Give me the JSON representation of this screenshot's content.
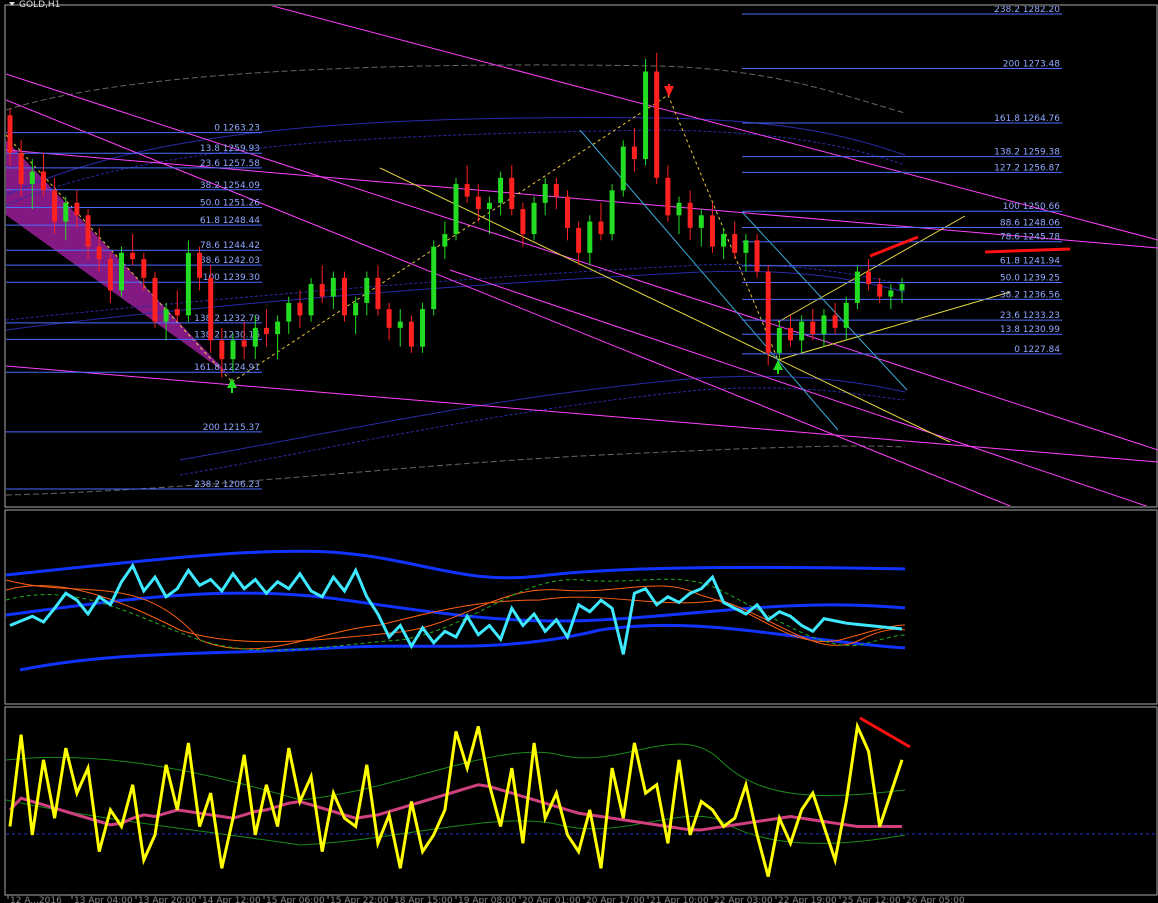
{
  "symbol_label": "GOLD,H1",
  "colors": {
    "background": "#000000",
    "fib_line": "#4a6cff",
    "fib_text": "#8fa8ff",
    "channel": "#ff40ff",
    "bull_candle": "#22dd22",
    "bear_candle": "#ff2020",
    "price_line": "#3ee8ff",
    "band": "#1133ff",
    "oscillator": "#ffff00",
    "osc_avg": "#d04080",
    "divergence": "#ff1010",
    "panel_border": "#aaaaaa"
  },
  "fib_left": [
    {
      "level": "0",
      "price": 1263.23,
      "label": "0 1263.23"
    },
    {
      "level": "13.8",
      "price": 1259.93,
      "label": "13.8 1259.93"
    },
    {
      "level": "23.6",
      "price": 1257.58,
      "label": "23.6 1257.58"
    },
    {
      "level": "38.2",
      "price": 1254.09,
      "label": "38.2 1254.09"
    },
    {
      "level": "50.0",
      "price": 1251.26,
      "label": "50.0 1251.26"
    },
    {
      "level": "61.8",
      "price": 1248.44,
      "label": "61.8 1248.44"
    },
    {
      "level": "78.6",
      "price": 1244.42,
      "label": "78.6 1244.42"
    },
    {
      "level": "88.6",
      "price": 1242.03,
      "label": "88.6 1242.03"
    },
    {
      "level": "100",
      "price": 1239.3,
      "label": "100 1239.30"
    },
    {
      "level": "138.2",
      "price": 1232.79,
      "label": "138.2 1232.79"
    },
    {
      "level": "138.2",
      "price": 1230.16,
      "label": "138.2 1230.16"
    },
    {
      "level": "161.8",
      "price": 1224.91,
      "label": "161.8 1224.91"
    },
    {
      "level": "200",
      "price": 1215.37,
      "label": "200 1215.37"
    },
    {
      "level": "238.2",
      "price": 1206.23,
      "label": "238.2 1206.23"
    }
  ],
  "fib_right": [
    {
      "level": "238.2",
      "price": 1282.2,
      "label": "238.2 1282.20"
    },
    {
      "level": "200",
      "price": 1273.48,
      "label": "200 1273.48"
    },
    {
      "level": "161.8",
      "price": 1264.76,
      "label": "161.8 1264.76"
    },
    {
      "level": "138.2",
      "price": 1259.38,
      "label": "138.2 1259.38"
    },
    {
      "level": "127.2",
      "price": 1256.87,
      "label": "127.2 1256.87"
    },
    {
      "level": "100",
      "price": 1250.66,
      "label": "100 1250.66"
    },
    {
      "level": "88.6",
      "price": 1248.06,
      "label": "88.6 1248.06"
    },
    {
      "level": "78.6",
      "price": 1245.78,
      "label": "78.6 1245.78"
    },
    {
      "level": "61.8",
      "price": 1241.94,
      "label": "61.8 1241.94"
    },
    {
      "level": "50.0",
      "price": 1239.25,
      "label": "50.0 1239.25"
    },
    {
      "level": "38.2",
      "price": 1236.56,
      "label": "38.2 1236.56"
    },
    {
      "level": "23.6",
      "price": 1233.23,
      "label": "23.6 1233.23"
    },
    {
      "level": "13.8",
      "price": 1230.99,
      "label": "13.8 1230.99"
    },
    {
      "level": "0",
      "price": 1227.84,
      "label": "0 1227.84"
    }
  ],
  "time_axis_labels": [
    "12 A...2016",
    "13 Apr 04:00",
    "13 Apr 20:00",
    "14 Apr 12:00",
    "15 Apr 06:00",
    "15 Apr 22:00",
    "18 Apr 15:00",
    "19 Apr 08:00",
    "20 Apr 01:00",
    "20 Apr 17:00",
    "21 Apr 10:00",
    "22 Apr 03:00",
    "22 Apr 19:00",
    "25 Apr 12:00",
    "26 Apr 05:00"
  ],
  "chart_data": [
    {
      "type": "candlestick",
      "title": "GOLD,H1",
      "ylim": [
        1200,
        1285
      ],
      "ohlc": [
        [
          1266,
          1267,
          1258,
          1260
        ],
        [
          1260,
          1262,
          1253,
          1255
        ],
        [
          1255,
          1259,
          1251,
          1257
        ],
        [
          1257,
          1260,
          1253,
          1254
        ],
        [
          1254,
          1256,
          1247,
          1249
        ],
        [
          1249,
          1253,
          1246,
          1252
        ],
        [
          1252,
          1254,
          1248,
          1250
        ],
        [
          1250,
          1251,
          1243,
          1245
        ],
        [
          1245,
          1248,
          1241,
          1243
        ],
        [
          1243,
          1244,
          1236,
          1238
        ],
        [
          1238,
          1245,
          1237,
          1244
        ],
        [
          1244,
          1247,
          1242,
          1243
        ],
        [
          1243,
          1244,
          1238,
          1240
        ],
        [
          1240,
          1241,
          1232,
          1233
        ],
        [
          1233,
          1236,
          1230,
          1235
        ],
        [
          1235,
          1238,
          1233,
          1234
        ],
        [
          1234,
          1246,
          1233,
          1244
        ],
        [
          1244,
          1245,
          1238,
          1240
        ],
        [
          1240,
          1242,
          1228,
          1230
        ],
        [
          1230,
          1232,
          1224,
          1227
        ],
        [
          1227,
          1231,
          1225,
          1230
        ],
        [
          1230,
          1233,
          1227,
          1229
        ],
        [
          1229,
          1234,
          1227,
          1232
        ],
        [
          1232,
          1235,
          1229,
          1231
        ],
        [
          1231,
          1234,
          1227,
          1233
        ],
        [
          1233,
          1237,
          1231,
          1236
        ],
        [
          1236,
          1238,
          1232,
          1234
        ],
        [
          1234,
          1240,
          1233,
          1239
        ],
        [
          1239,
          1242,
          1236,
          1237
        ],
        [
          1237,
          1241,
          1235,
          1240
        ],
        [
          1240,
          1241,
          1233,
          1234
        ],
        [
          1234,
          1237,
          1231,
          1236
        ],
        [
          1236,
          1241,
          1234,
          1240
        ],
        [
          1240,
          1242,
          1234,
          1235
        ],
        [
          1235,
          1236,
          1230,
          1232
        ],
        [
          1232,
          1235,
          1229,
          1233
        ],
        [
          1233,
          1234,
          1228,
          1229
        ],
        [
          1229,
          1236,
          1228,
          1235
        ],
        [
          1235,
          1246,
          1234,
          1245
        ],
        [
          1245,
          1249,
          1243,
          1247
        ],
        [
          1247,
          1256,
          1246,
          1255
        ],
        [
          1255,
          1258,
          1252,
          1253
        ],
        [
          1253,
          1255,
          1249,
          1251
        ],
        [
          1251,
          1253,
          1247,
          1252
        ],
        [
          1252,
          1257,
          1250,
          1256
        ],
        [
          1256,
          1258,
          1250,
          1251
        ],
        [
          1251,
          1252,
          1245,
          1247
        ],
        [
          1247,
          1253,
          1246,
          1252
        ],
        [
          1252,
          1256,
          1250,
          1255
        ],
        [
          1255,
          1256,
          1251,
          1253
        ],
        [
          1253,
          1254,
          1246,
          1248
        ],
        [
          1248,
          1249,
          1242,
          1244
        ],
        [
          1244,
          1250,
          1242,
          1249
        ],
        [
          1249,
          1252,
          1246,
          1247
        ],
        [
          1247,
          1255,
          1246,
          1254
        ],
        [
          1254,
          1262,
          1253,
          1261
        ],
        [
          1261,
          1264,
          1257,
          1259
        ],
        [
          1259,
          1275,
          1258,
          1273
        ],
        [
          1273,
          1276,
          1255,
          1256
        ],
        [
          1256,
          1258,
          1249,
          1250
        ],
        [
          1250,
          1253,
          1247,
          1252
        ],
        [
          1252,
          1254,
          1246,
          1248
        ],
        [
          1248,
          1251,
          1245,
          1250
        ],
        [
          1250,
          1252,
          1244,
          1245
        ],
        [
          1245,
          1248,
          1243,
          1247
        ],
        [
          1247,
          1249,
          1243,
          1244
        ],
        [
          1244,
          1247,
          1241,
          1246
        ],
        [
          1246,
          1247,
          1240,
          1241
        ],
        [
          1241,
          1242,
          1226,
          1228
        ],
        [
          1228,
          1233,
          1227,
          1232
        ],
        [
          1232,
          1234,
          1229,
          1230
        ],
        [
          1230,
          1234,
          1228,
          1233
        ],
        [
          1233,
          1235,
          1230,
          1231
        ],
        [
          1231,
          1235,
          1229,
          1234
        ],
        [
          1234,
          1236,
          1231,
          1232
        ],
        [
          1232,
          1237,
          1230,
          1236
        ],
        [
          1236,
          1242,
          1235,
          1241
        ],
        [
          1241,
          1243,
          1238,
          1239
        ],
        [
          1239,
          1240,
          1236,
          1237
        ],
        [
          1237,
          1239,
          1235,
          1238
        ],
        [
          1238,
          1240,
          1236,
          1239
        ]
      ]
    },
    {
      "type": "line",
      "series": [
        {
          "values": [
            0.3,
            0.34,
            0.38,
            0.33,
            0.45,
            0.58,
            0.52,
            0.4,
            0.55,
            0.48,
            0.68,
            0.82,
            0.6,
            0.72,
            0.55,
            0.62,
            0.78,
            0.65,
            0.7,
            0.6,
            0.75,
            0.62,
            0.7,
            0.58,
            0.68,
            0.62,
            0.75,
            0.6,
            0.55,
            0.72,
            0.6,
            0.78,
            0.55,
            0.4,
            0.2,
            0.3,
            0.12,
            0.28,
            0.15,
            0.25,
            0.2,
            0.38,
            0.22,
            0.3,
            0.18,
            0.45,
            0.3,
            0.4,
            0.25,
            0.35,
            0.2,
            0.48,
            0.42,
            0.52,
            0.45,
            0.05,
            0.58,
            0.62,
            0.48,
            0.55,
            0.5,
            0.58,
            0.62,
            0.72,
            0.5,
            0.45,
            0.4,
            0.48,
            0.35,
            0.42,
            0.38,
            0.3,
            0.25,
            0.36,
            0.34,
            0.32,
            0.31,
            0.3,
            0.29,
            0.28,
            0.27
          ]
        }
      ]
    },
    {
      "type": "line",
      "series": [
        {
          "values": [
            0.35,
            0.9,
            0.3,
            0.75,
            0.4,
            0.82,
            0.55,
            0.7,
            0.2,
            0.45,
            0.35,
            0.6,
            0.15,
            0.3,
            0.72,
            0.45,
            0.85,
            0.35,
            0.55,
            0.1,
            0.4,
            0.78,
            0.3,
            0.6,
            0.35,
            0.82,
            0.5,
            0.65,
            0.2,
            0.55,
            0.4,
            0.35,
            0.72,
            0.25,
            0.42,
            0.1,
            0.5,
            0.2,
            0.3,
            0.45,
            0.92,
            0.7,
            0.95,
            0.6,
            0.35,
            0.7,
            0.25,
            0.85,
            0.4,
            0.55,
            0.3,
            0.2,
            0.45,
            0.1,
            0.7,
            0.4,
            0.85,
            0.55,
            0.6,
            0.25,
            0.75,
            0.3,
            0.5,
            0.45,
            0.35,
            0.4,
            0.6,
            0.3,
            0.05,
            0.4,
            0.25,
            0.45,
            0.55,
            0.35,
            0.15,
            0.5,
            0.95,
            0.8,
            0.35,
            0.55,
            0.75
          ]
        },
        {
          "values": [
            0.45,
            0.52,
            0.5,
            0.48,
            0.46,
            0.44,
            0.42,
            0.4,
            0.38,
            0.36,
            0.37,
            0.4,
            0.42,
            0.41,
            0.43,
            0.45,
            0.44,
            0.43,
            0.42,
            0.41,
            0.4,
            0.42,
            0.44,
            0.45,
            0.47,
            0.49,
            0.5,
            0.48,
            0.46,
            0.44,
            0.42,
            0.4,
            0.41,
            0.42,
            0.44,
            0.46,
            0.48,
            0.5,
            0.52,
            0.54,
            0.56,
            0.58,
            0.6,
            0.59,
            0.57,
            0.55,
            0.53,
            0.51,
            0.49,
            0.47,
            0.45,
            0.43,
            0.42,
            0.41,
            0.4,
            0.39,
            0.38,
            0.37,
            0.36,
            0.35,
            0.34,
            0.33,
            0.33,
            0.34,
            0.35,
            0.36,
            0.37,
            0.38,
            0.39,
            0.4,
            0.41,
            0.4,
            0.39,
            0.38,
            0.37,
            0.36,
            0.35,
            0.35,
            0.35,
            0.35,
            0.35
          ]
        }
      ]
    }
  ]
}
